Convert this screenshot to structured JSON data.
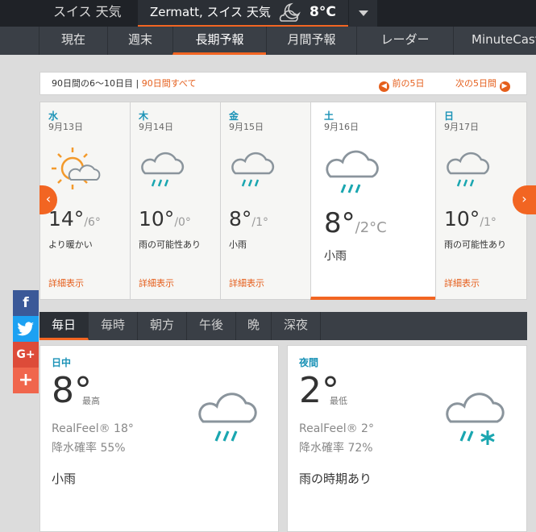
{
  "topbar": {
    "country": "スイス 天気",
    "location": "Zermatt, スイス 天気",
    "current_temp": "8°C",
    "moon_icon": "moon-cloud-icon",
    "dropdown_icon": "chevron-down-icon"
  },
  "nav": {
    "items": [
      "現在",
      "週末",
      "長期予報",
      "月間予報",
      "レーダー",
      "MinuteCast"
    ],
    "active": "長期予報"
  },
  "range": {
    "label": "90日間の6〜10日目",
    "sep": " | ",
    "all_link": "90日間すべて",
    "prev": "前の5日",
    "next": "次の5日間"
  },
  "days": [
    {
      "name": "水",
      "date": "9月13日",
      "hi": "14°",
      "lo": "/6°",
      "phrase": "より暖かい",
      "more": "詳細表示",
      "icon": "sun-cloud-icon"
    },
    {
      "name": "木",
      "date": "9月14日",
      "hi": "10°",
      "lo": "/0°",
      "phrase": "雨の可能性あり",
      "more": "詳細表示",
      "icon": "cloud-rain-icon"
    },
    {
      "name": "金",
      "date": "9月15日",
      "hi": "8°",
      "lo": "/1°",
      "phrase": "小雨",
      "more": "詳細表示",
      "icon": "cloud-rain-icon"
    },
    {
      "name": "土",
      "date": "9月16日",
      "hi": "8°",
      "lo": "/2°C",
      "phrase": "小雨",
      "more": "",
      "icon": "cloud-rain-icon"
    },
    {
      "name": "日",
      "date": "9月17日",
      "hi": "10°",
      "lo": "/1°",
      "phrase": "雨の可能性あり",
      "more": "詳細表示",
      "icon": "cloud-rain-icon"
    }
  ],
  "social": [
    {
      "glyph": "f",
      "icon": "facebook-icon",
      "color": "#3b5998"
    },
    {
      "glyph": "t",
      "icon": "twitter-icon",
      "color": "#1da1f2"
    },
    {
      "glyph": "G+",
      "icon": "google-plus-icon",
      "color": "#dd4b39"
    },
    {
      "glyph": "+",
      "icon": "share-plus-icon",
      "color": "#f0664d"
    }
  ],
  "tabs": {
    "items": [
      "毎日",
      "毎時",
      "朝方",
      "午後",
      "晩",
      "深夜"
    ],
    "active": "毎日"
  },
  "day_panel": {
    "label": "日中",
    "temp": "8°",
    "sub": "最高",
    "realfeel": "RealFeel® 18°",
    "precip": "降水確率 55%",
    "phrase": "小雨",
    "icon": "cloud-rain-icon"
  },
  "night_panel": {
    "label": "夜間",
    "temp": "2°",
    "sub": "最低",
    "realfeel": "RealFeel® 2°",
    "precip": "降水確率 72%",
    "phrase": "雨の時期あり",
    "icon": "cloud-rain-snow-icon"
  },
  "colors": {
    "accent": "#f26522",
    "link": "#e55f1c",
    "label_blue": "#1b93b7",
    "rain_teal": "#1aa6b0",
    "cloud_grey": "#8a949c"
  }
}
